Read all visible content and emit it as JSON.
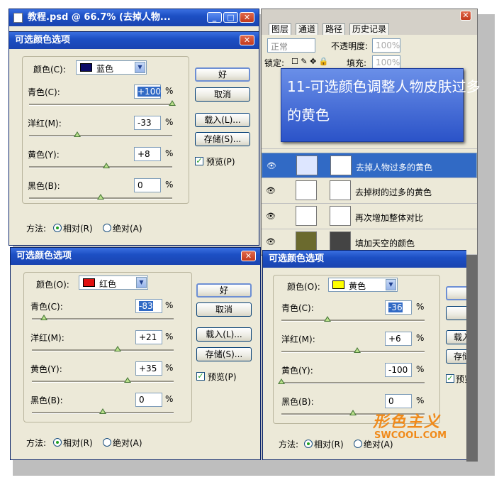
{
  "doc_window": {
    "title": "教程.psd @ 66.7% (去掉人物...",
    "minimize": "_",
    "maximize": "□",
    "close": "✕"
  },
  "layers_panel": {
    "tabs": [
      "图层",
      "通道",
      "路径",
      "历史记录"
    ],
    "blend_mode": "正常",
    "opacity_label": "不透明度:",
    "opacity_value": "100%",
    "lock_label": "锁定:",
    "fill_label": "填充:",
    "fill_value": "100%",
    "window_close": "✕",
    "layers": [
      {
        "name": "去掉人物过多的黄色",
        "selected": true
      },
      {
        "name": "去掉树的过多的黄色",
        "selected": false
      },
      {
        "name": "再次增加整体对比",
        "selected": false
      },
      {
        "name": "填加天空的颜色",
        "selected": false
      }
    ]
  },
  "callout": {
    "line1": "11-可选颜色调整人物皮肤过多",
    "line2": "的黄色"
  },
  "watermark": {
    "logo": "形色主义",
    "site": "SWCOOL.COM"
  },
  "dialogs": [
    {
      "title": "可选颜色选项",
      "close": "✕",
      "color_label": "颜色(C):",
      "color_value": "蓝色",
      "swatch": "#0a0a66",
      "sliders": [
        {
          "label": "青色(C):",
          "value": "+100",
          "highlighted": true,
          "level": 1.0
        },
        {
          "label": "洋红(M):",
          "value": "-33",
          "highlighted": false,
          "level": 0.335
        },
        {
          "label": "黄色(Y):",
          "value": "+8",
          "highlighted": false,
          "level": 0.54
        },
        {
          "label": "黑色(B):",
          "value": "0",
          "highlighted": false,
          "level": 0.5
        }
      ],
      "unit": "%",
      "buttons": {
        "ok": "好",
        "cancel": "取消",
        "load": "载入(L)...",
        "save": "存储(S)..."
      },
      "preview_label": "预览(P)",
      "method_label": "方法:",
      "relative_label": "相对(R)",
      "absolute_label": "绝对(A)"
    },
    {
      "title": "可选颜色选项",
      "close": "✕",
      "color_label": "颜色(O):",
      "color_value": "红色",
      "swatch": "#e01010",
      "sliders": [
        {
          "label": "青色(C):",
          "value": "-83",
          "highlighted": true,
          "level": 0.085
        },
        {
          "label": "洋红(M):",
          "value": "+21",
          "highlighted": false,
          "level": 0.605
        },
        {
          "label": "黄色(Y):",
          "value": "+35",
          "highlighted": false,
          "level": 0.675
        },
        {
          "label": "黑色(B):",
          "value": "0",
          "highlighted": false,
          "level": 0.5
        }
      ],
      "unit": "%",
      "buttons": {
        "ok": "好",
        "cancel": "取消",
        "load": "载入(L)...",
        "save": "存储(S)..."
      },
      "preview_label": "预览(P)",
      "method_label": "方法:",
      "relative_label": "相对(R)",
      "absolute_label": "绝对(A)"
    },
    {
      "title": "可选颜色选项",
      "close": "✕",
      "color_label": "颜色(O):",
      "color_value": "黄色",
      "swatch": "#ffff00",
      "sliders": [
        {
          "label": "青色(C):",
          "value": "-36",
          "highlighted": true,
          "level": 0.32
        },
        {
          "label": "洋红(M):",
          "value": "+6",
          "highlighted": false,
          "level": 0.53
        },
        {
          "label": "黄色(Y):",
          "value": "-100",
          "highlighted": false,
          "level": 0.0
        },
        {
          "label": "黑色(B):",
          "value": "0",
          "highlighted": false,
          "level": 0.5
        }
      ],
      "unit": "%",
      "buttons": {
        "ok": "",
        "cancel": "",
        "load": "载入",
        "save": "存储"
      },
      "preview_label": "预览",
      "method_label": "方法:",
      "relative_label": "相对(R)",
      "absolute_label": "绝对(A)"
    }
  ]
}
